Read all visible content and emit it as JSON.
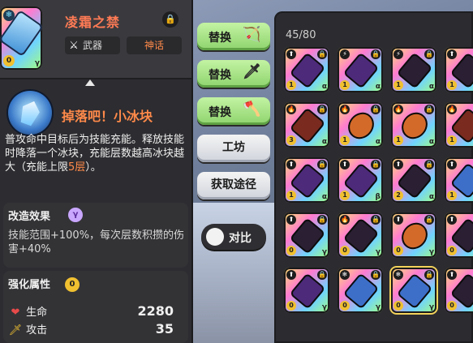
{
  "item": {
    "name": "凌霜之禁",
    "type_label": "武器",
    "tier_label": "神话",
    "level": "0",
    "rarity": "γ",
    "icons": {
      "element": "snowflake-icon",
      "lock": "lock-icon",
      "type": "crossed-swords-icon"
    }
  },
  "skill": {
    "name": "掉落吧！小冰块",
    "desc_pre": "普攻命中目标后为技能充能。释放技能时降落一个冰块，充能层数越高冰块越大（充能上限",
    "desc_num": "5层",
    "desc_post": "）。"
  },
  "mod": {
    "title": "改造效果",
    "badge": "γ",
    "text": "技能范围+100%，每次层数积攒的伤害+40%"
  },
  "enhance": {
    "title": "强化属性",
    "badge": "0",
    "stats": [
      {
        "label": "生命",
        "value": "2280",
        "icon": "heart-icon",
        "color": "#e84a4a"
      },
      {
        "label": "攻击",
        "value": "35",
        "icon": "sword-icon",
        "color": "#f0c030"
      }
    ]
  },
  "buttons": {
    "replace": "替换",
    "workshop": "工坊",
    "obtain": "获取途径",
    "compare": "对比",
    "replace_icons": [
      "bow-icon",
      "sword-icon",
      "axe-icon"
    ]
  },
  "inventory": {
    "count": "45/80",
    "rows": [
      [
        {
          "tag": "⬆",
          "lock": "🔒",
          "level": "1",
          "rarity": "α",
          "style": "purple"
        },
        {
          "tag": "⚡",
          "lock": "🔒",
          "level": "1",
          "rarity": "α",
          "style": "purple"
        },
        {
          "tag": "⚡",
          "lock": "🔒",
          "level": "1",
          "rarity": "α",
          "style": ""
        },
        {
          "tag": "⬆",
          "lock": "🔒",
          "level": "1",
          "rarity": "α",
          "style": ""
        }
      ],
      [
        {
          "tag": "🔥",
          "lock": "🔒",
          "level": "3",
          "rarity": "α",
          "style": "red"
        },
        {
          "tag": "🔥",
          "lock": "🔒",
          "level": "1",
          "rarity": "α",
          "style": "ore"
        },
        {
          "tag": "🔥",
          "lock": "🔒",
          "level": "1",
          "rarity": "α",
          "style": "ore"
        },
        {
          "tag": "🔥",
          "lock": "🔒",
          "level": "1",
          "rarity": "α",
          "style": "red"
        }
      ],
      [
        {
          "tag": "⬆",
          "lock": "🔒",
          "level": "1",
          "rarity": "α",
          "style": "purple"
        },
        {
          "tag": "⬆",
          "lock": "🔒",
          "level": "1",
          "rarity": "β",
          "style": "purple"
        },
        {
          "tag": "⬆",
          "lock": "🔒",
          "level": "2",
          "rarity": "α",
          "style": ""
        },
        {
          "tag": "⬆",
          "lock": "🔒",
          "level": "1",
          "rarity": "α",
          "style": "blue"
        }
      ],
      [
        {
          "tag": "⬆",
          "lock": "🔒",
          "level": "0",
          "rarity": "γ",
          "style": ""
        },
        {
          "tag": "🔥",
          "lock": "🔒",
          "level": "0",
          "rarity": "γ",
          "style": ""
        },
        {
          "tag": "⬆",
          "lock": "🔒",
          "level": "0",
          "rarity": "γ",
          "style": "ore"
        },
        {
          "tag": "⬆",
          "lock": "🔒",
          "level": "0",
          "rarity": "γ",
          "style": ""
        }
      ],
      [
        {
          "tag": "⬆",
          "lock": "🔒",
          "level": "0",
          "rarity": "γ",
          "style": "purple"
        },
        {
          "tag": "❄",
          "lock": "🔒",
          "level": "0",
          "rarity": "γ",
          "style": "blue"
        },
        {
          "tag": "❄",
          "lock": "🔒",
          "level": "0",
          "rarity": "γ",
          "style": "blue",
          "selected": true
        },
        {
          "tag": "⬆",
          "lock": "🔒",
          "level": "0",
          "rarity": "γ",
          "style": ""
        }
      ]
    ]
  }
}
